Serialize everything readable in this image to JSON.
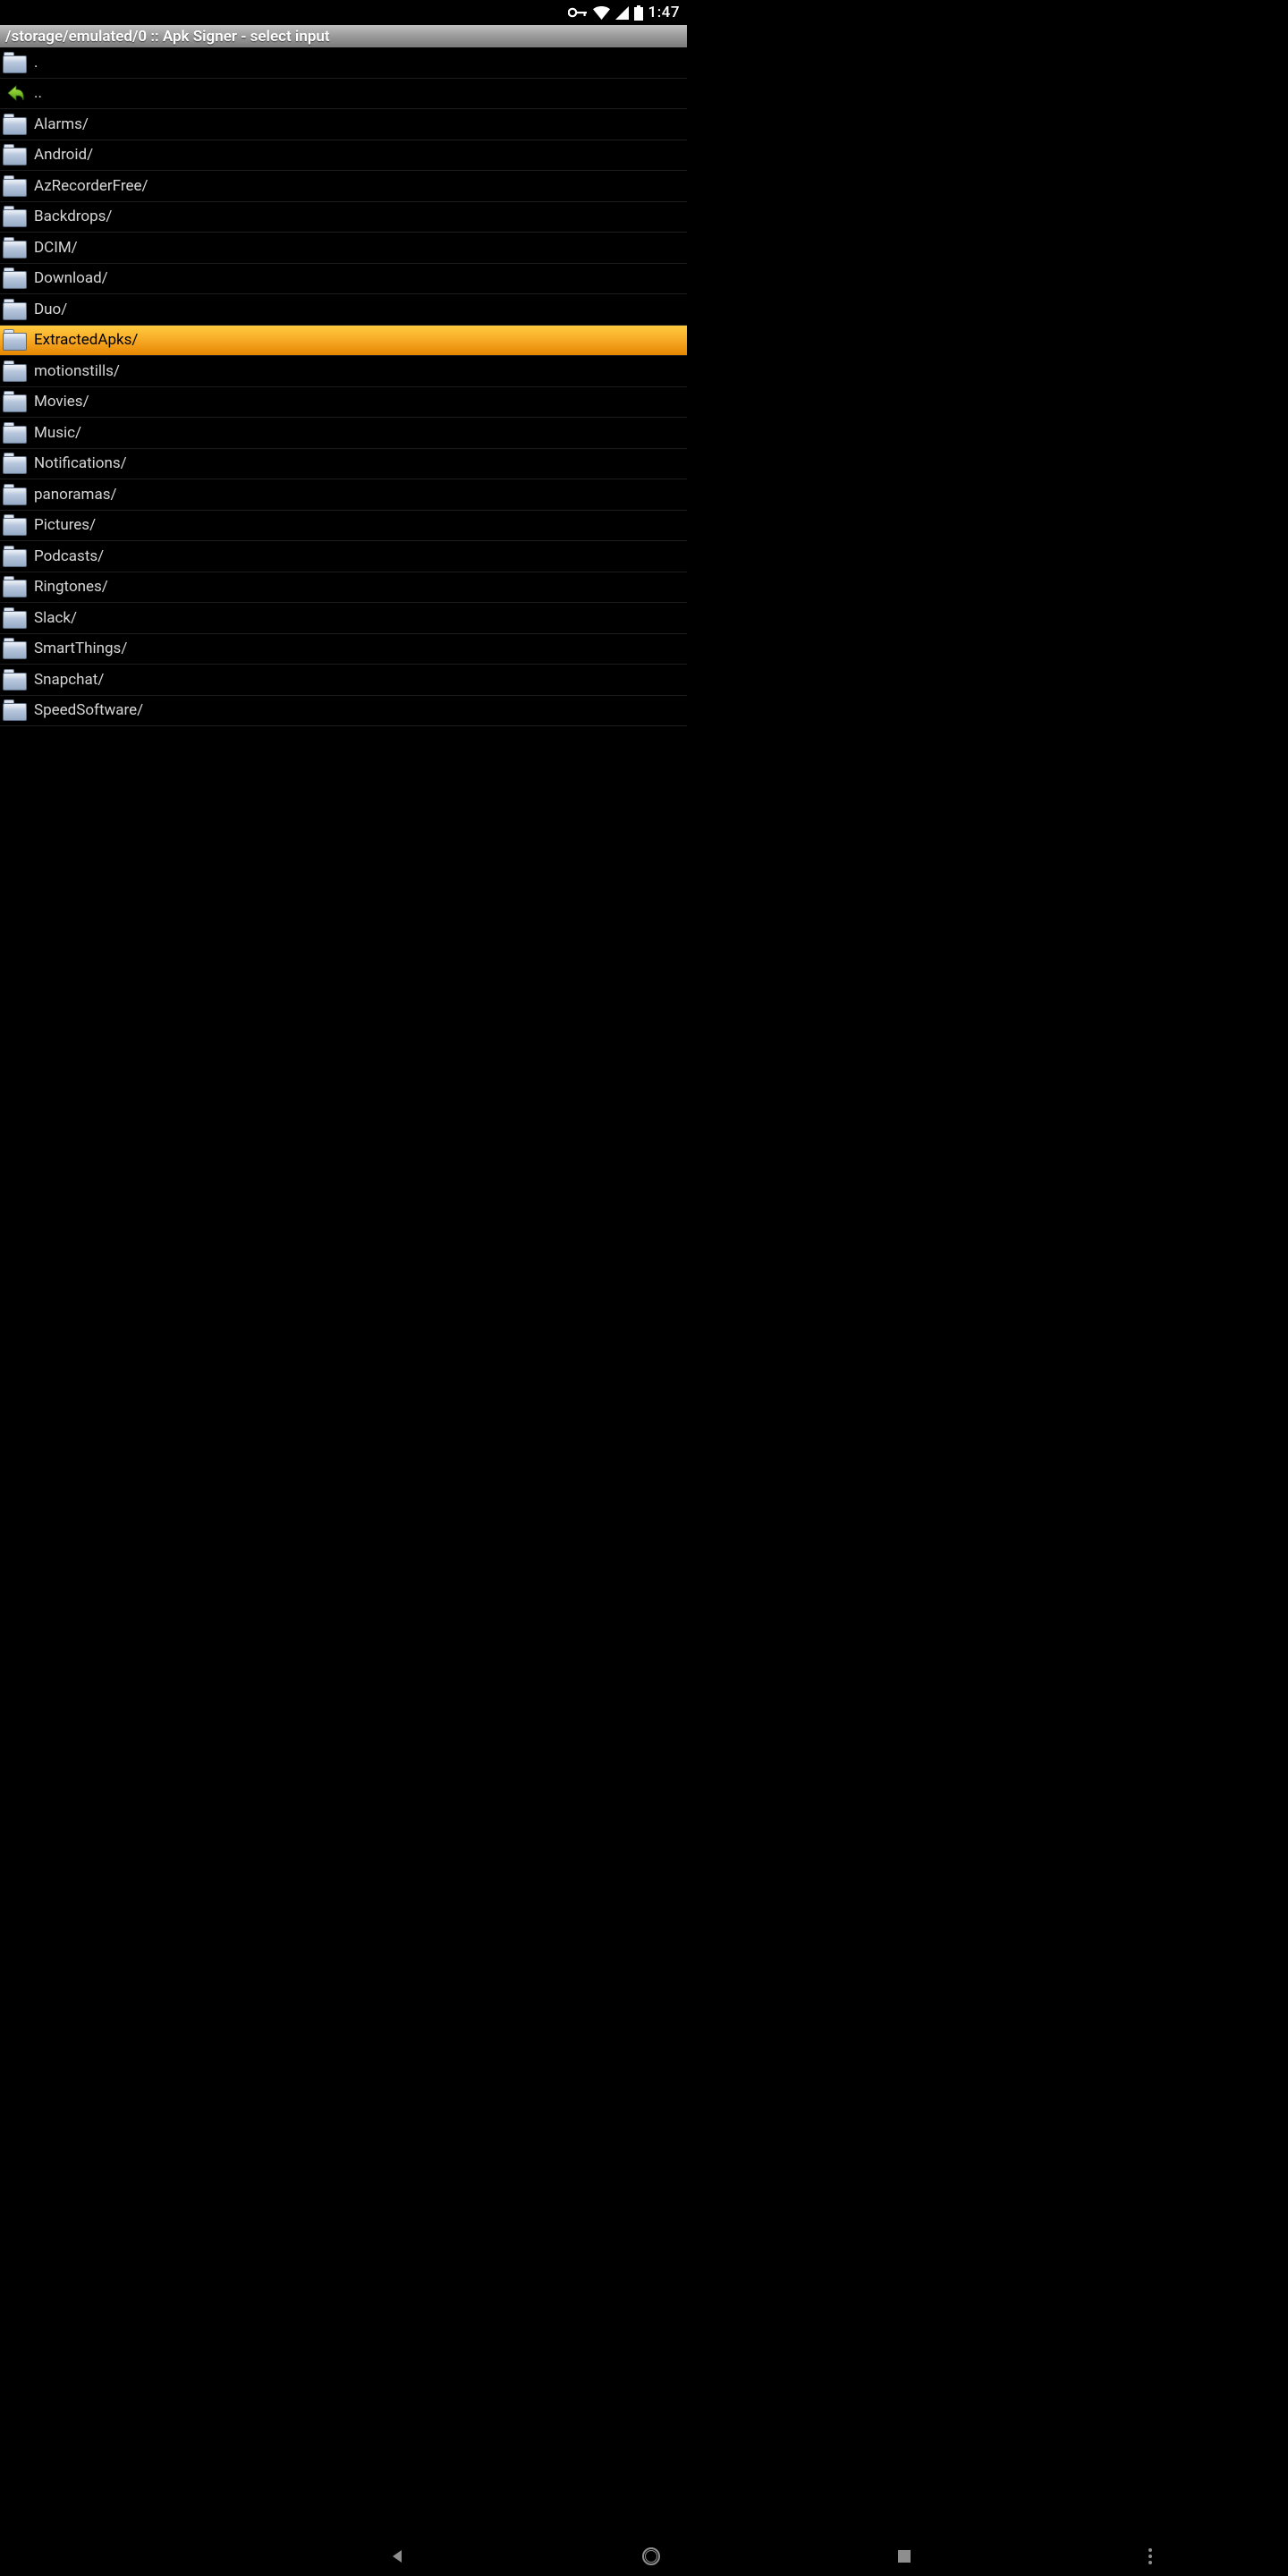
{
  "status_bar": {
    "time": "1:47"
  },
  "title_bar": {
    "text": "/storage/emulated/0 :: Apk Signer - select input"
  },
  "items": [
    {
      "label": ".",
      "icon": "folder",
      "selected": false
    },
    {
      "label": "..",
      "icon": "back",
      "selected": false
    },
    {
      "label": "Alarms/",
      "icon": "folder",
      "selected": false
    },
    {
      "label": "Android/",
      "icon": "folder",
      "selected": false
    },
    {
      "label": "AzRecorderFree/",
      "icon": "folder",
      "selected": false
    },
    {
      "label": "Backdrops/",
      "icon": "folder",
      "selected": false
    },
    {
      "label": "DCIM/",
      "icon": "folder",
      "selected": false
    },
    {
      "label": "Download/",
      "icon": "folder",
      "selected": false
    },
    {
      "label": "Duo/",
      "icon": "folder",
      "selected": false
    },
    {
      "label": "ExtractedApks/",
      "icon": "folder",
      "selected": true
    },
    {
      "label": "motionstills/",
      "icon": "folder",
      "selected": false
    },
    {
      "label": "Movies/",
      "icon": "folder",
      "selected": false
    },
    {
      "label": "Music/",
      "icon": "folder",
      "selected": false
    },
    {
      "label": "Notifications/",
      "icon": "folder",
      "selected": false
    },
    {
      "label": "panoramas/",
      "icon": "folder",
      "selected": false
    },
    {
      "label": "Pictures/",
      "icon": "folder",
      "selected": false
    },
    {
      "label": "Podcasts/",
      "icon": "folder",
      "selected": false
    },
    {
      "label": "Ringtones/",
      "icon": "folder",
      "selected": false
    },
    {
      "label": "Slack/",
      "icon": "folder",
      "selected": false
    },
    {
      "label": "SmartThings/",
      "icon": "folder",
      "selected": false
    },
    {
      "label": "Snapchat/",
      "icon": "folder",
      "selected": false
    },
    {
      "label": "SpeedSoftware/",
      "icon": "folder",
      "selected": false
    }
  ]
}
